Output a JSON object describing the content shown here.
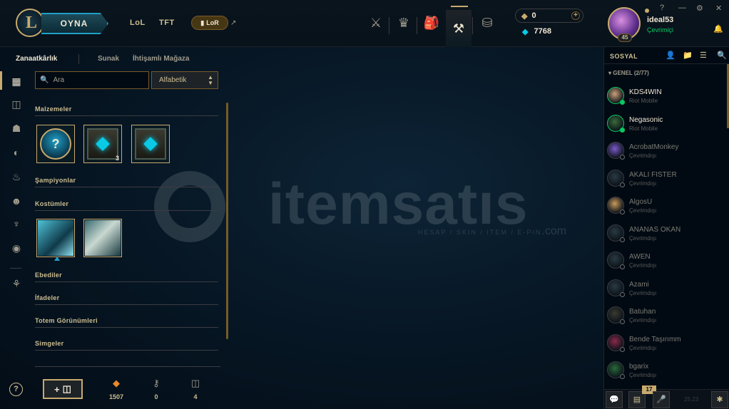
{
  "header": {
    "logo_letter": "L",
    "play_label": "OYNA",
    "nav": [
      {
        "label": "LoL"
      },
      {
        "label": "TFT"
      }
    ],
    "lor_label": "LoR",
    "external_icon": "↗",
    "rp_value": "0",
    "be_value": "7768",
    "username": "ideal53",
    "status": "Çevrimiçi",
    "level": "45",
    "icons": [
      "clash-icon",
      "ranked-icon",
      "collection-icon",
      "loot-icon",
      "store-icon"
    ]
  },
  "subtabs": [
    "Zanaatkârlık",
    "Sunak",
    "İhtişamlı Mağaza"
  ],
  "search": {
    "placeholder": "Ara"
  },
  "sort": {
    "value": "Alfabetik"
  },
  "sections": {
    "materials": "Malzemeler",
    "champions": "Şampiyonlar",
    "skins": "Kostümler",
    "eternals": "Ebediler",
    "emotes": "İfadeler",
    "totems": "Totem Görünümleri",
    "icons": "Simgeler"
  },
  "materials": [
    {
      "glyph": "?",
      "count": ""
    },
    {
      "count": "3"
    },
    {
      "count": ""
    }
  ],
  "stats": [
    {
      "value": "1507",
      "icon": "orange-essence-icon"
    },
    {
      "value": "0",
      "icon": "key-icon"
    },
    {
      "value": "4",
      "icon": "chest-icon"
    }
  ],
  "add_label": "+ ",
  "help": "?",
  "watermark": {
    "brand": "itemsatıs",
    "sub": "HESAP / SKIN / ITEM / E-PIN",
    "tld": ".com"
  },
  "social": {
    "title": "SOSYAL",
    "group": "▾ GENEL (2/77)",
    "friends": [
      {
        "name": "KDS4WIN",
        "sub": "Riot Mobile",
        "online": true
      },
      {
        "name": "Negasonic",
        "sub": "Riot Mobile",
        "online": true
      },
      {
        "name": "AcrobatMonkey",
        "sub": "Çevrimdışı",
        "online": false
      },
      {
        "name": "AKALI FISTER",
        "sub": "Çevrimdışı",
        "online": false
      },
      {
        "name": "AlgosU",
        "sub": "Çevrimdışı",
        "online": false
      },
      {
        "name": "ANANAS OKAN",
        "sub": "Çevrimdışı",
        "online": false
      },
      {
        "name": "AWEN",
        "sub": "Çevrimdışı",
        "online": false
      },
      {
        "name": "Azami",
        "sub": "Çevrimdışı",
        "online": false
      },
      {
        "name": "Batuhan",
        "sub": "Çevrimdışı",
        "online": false
      },
      {
        "name": "Bende Taşırımm",
        "sub": "Çevrimdışı",
        "online": false
      },
      {
        "name": "bgarix",
        "sub": "Çevrimdışı",
        "online": false
      }
    ],
    "badge": "17",
    "version": "25.23"
  }
}
